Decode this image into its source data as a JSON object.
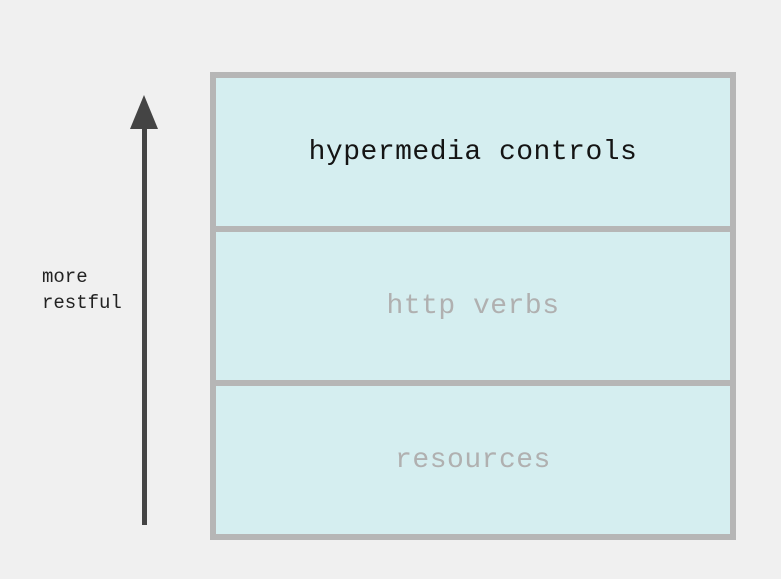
{
  "arrow": {
    "label_line1": "more",
    "label_line2": "restful"
  },
  "levels": [
    {
      "label": "hypermedia controls",
      "emphasized": true
    },
    {
      "label": "http verbs",
      "emphasized": false
    },
    {
      "label": "resources",
      "emphasized": false
    }
  ]
}
